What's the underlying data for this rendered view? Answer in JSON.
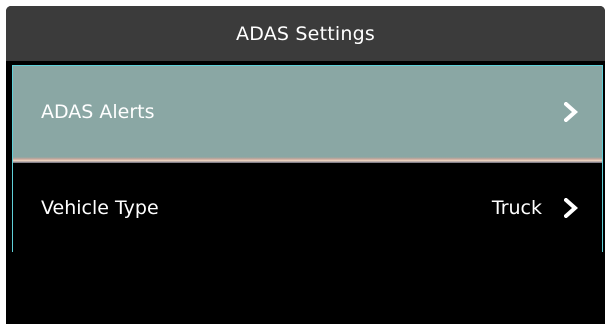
{
  "header": {
    "title": "ADAS Settings"
  },
  "menu": {
    "items": [
      {
        "label": "ADAS Alerts",
        "value": "",
        "icon": "chevron-right-icon",
        "selected": true
      },
      {
        "label": "Vehicle Type",
        "value": "Truck",
        "icon": "chevron-right-icon",
        "selected": false
      }
    ]
  },
  "colors": {
    "background": "#000000",
    "titlebar": "#3b3b3b",
    "selected_row": "#8aa7a4",
    "focus_border": "#5fd0d8",
    "text": "#ffffff"
  }
}
